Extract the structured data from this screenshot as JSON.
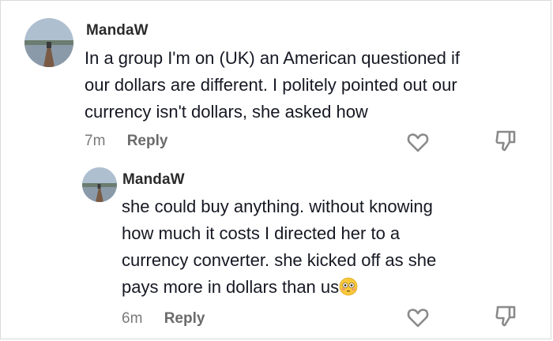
{
  "comments": [
    {
      "username": "MandaW",
      "lines": [
        "In a group I'm on (UK) an American questioned if",
        "our dollars are different. I politely pointed out our",
        "currency isn't dollars, she asked how"
      ],
      "time": "7m",
      "reply_label": "Reply",
      "like_icon": "heart-outline-icon",
      "dislike_icon": "thumbs-down-outline-icon"
    },
    {
      "username": "MandaW",
      "lines": [
        "she could buy anything. without knowing",
        "how much it costs I directed her to a",
        "currency converter. she kicked off as she",
        "pays more in dollars than us"
      ],
      "trailing_emoji": "flushed-face-emoji",
      "time": "6m",
      "reply_label": "Reply",
      "like_icon": "heart-outline-icon",
      "dislike_icon": "thumbs-down-outline-icon"
    }
  ],
  "colors": {
    "text": "#161823",
    "muted": "#7a7a7a",
    "icon": "#8a8a8a"
  }
}
